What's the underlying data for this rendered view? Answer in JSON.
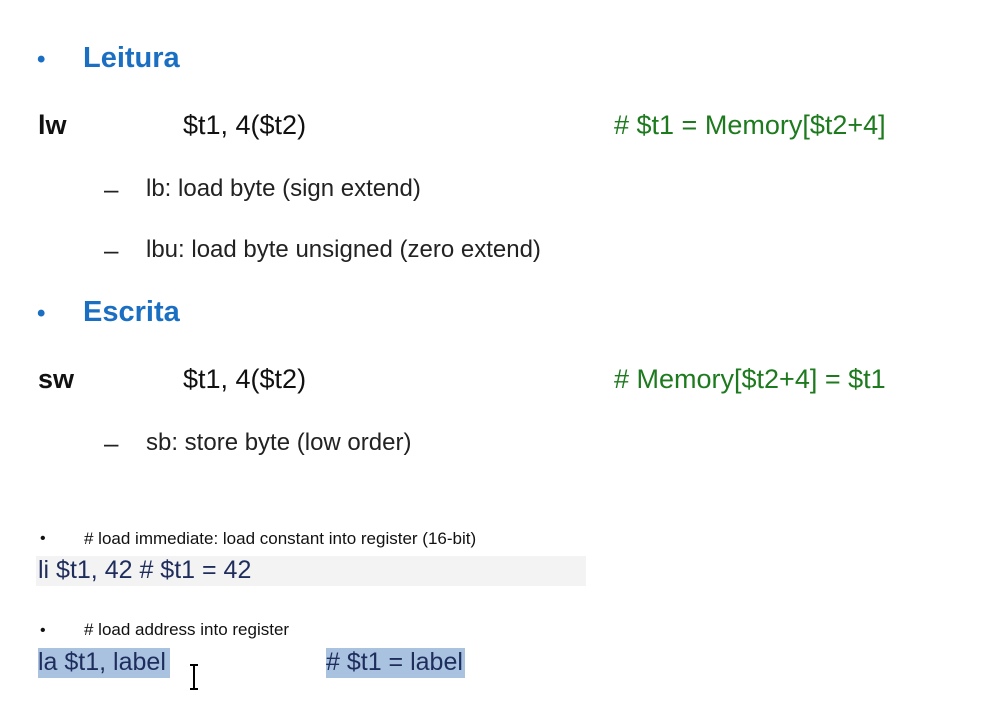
{
  "section_read": {
    "bullet": "•",
    "title": "Leitura",
    "instruction": {
      "mnemonic": "lw",
      "operands": "$t1, 4($t2)",
      "comment": "# $t1 = Memory[$t2+4]"
    },
    "subitems": [
      {
        "dash": "–",
        "text": "lb: load byte (sign extend)"
      },
      {
        "dash": "–",
        "text": "lbu: load byte unsigned (zero extend)"
      }
    ]
  },
  "section_write": {
    "bullet": "•",
    "title": "Escrita",
    "instruction": {
      "mnemonic": "sw",
      "operands": "$t1, 4($t2)",
      "comment": "# Memory[$t2+4] = $t1"
    },
    "subitems": [
      {
        "dash": "–",
        "text": "sb: store byte (low order)"
      }
    ]
  },
  "load_immediate": {
    "bullet": "•",
    "note": "# load immediate: load constant into register (16-bit)",
    "code": "li $t1, 42  # $t1 = 42"
  },
  "load_address": {
    "bullet": "•",
    "note": "# load address into register",
    "code_left": "la $t1, label",
    "code_right": "# $t1 = label"
  },
  "colors": {
    "heading_blue": "#1a6fc2",
    "comment_green": "#1e7a1e",
    "code_navy": "#1f2d5c",
    "selection_highlight": "#a9c2e0"
  },
  "icons": {
    "cursor": "text-cursor-icon"
  }
}
